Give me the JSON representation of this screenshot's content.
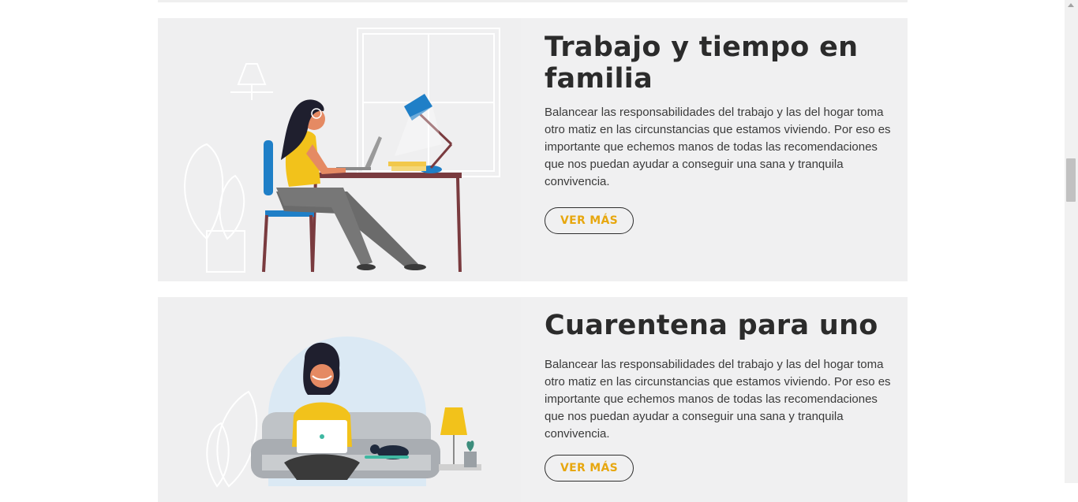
{
  "cards": [
    {
      "title": "Trabajo y tiempo en familia",
      "description": "Balancear las responsabilidades del trabajo y las del hogar toma otro matiz en las circunstancias que estamos viviendo. Por eso es importante que echemos manos de todas las recomendaciones que nos puedan ayudar a conseguir una sana y tranquila convivencia.",
      "button_label": "VER MÁS"
    },
    {
      "title": "Cuarentena para uno",
      "description": "Balancear las responsabilidades del trabajo y las del hogar toma otro matiz en las circunstancias que estamos viviendo. Por eso es importante que echemos manos de todas las recomendaciones que nos puedan ayudar a conseguir una sana y tranquila convivencia.",
      "button_label": "VER MÁS"
    }
  ],
  "colors": {
    "accent": "#e7a70f",
    "card_background": "#f0f0f1",
    "title": "#2b2b2b"
  }
}
